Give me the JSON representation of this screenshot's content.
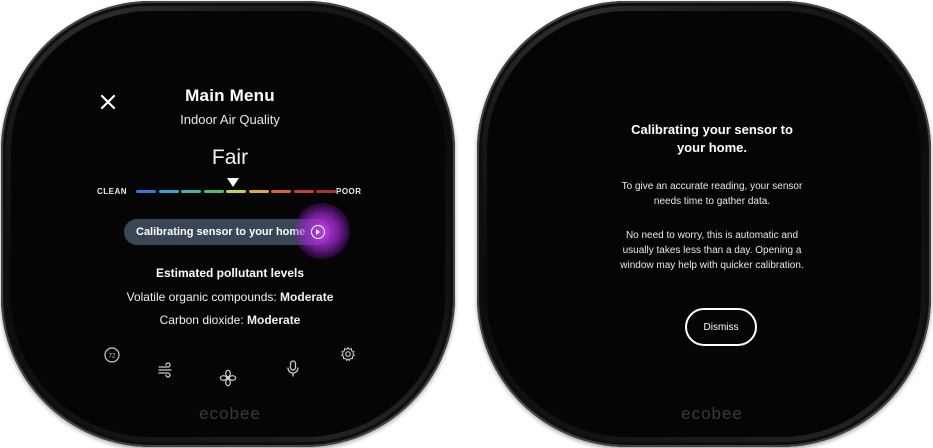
{
  "left_screen": {
    "title": "Main Menu",
    "subtitle": "Indoor Air Quality",
    "rating": "Fair",
    "scale_left": "CLEAN",
    "scale_right": "POOR",
    "scale_colors": [
      "#3a78d8",
      "#2fa6d9",
      "#3cb8a0",
      "#4cc06a",
      "#c9d341",
      "#e0a43a",
      "#d9603c",
      "#c93a3a",
      "#b32e2e"
    ],
    "calibration_pill": "Calibrating sensor to your home",
    "estimated_heading": "Estimated pollutant levels",
    "voc_label": "Volatile organic compounds: ",
    "voc_value": "Moderate",
    "co2_label": "Carbon dioxide: ",
    "co2_value": "Moderate",
    "temp_icon_text": "72",
    "brand": "ecobee"
  },
  "right_screen": {
    "title_line1": "Calibrating your sensor to",
    "title_line2": "your home.",
    "para1_line1": "To give an accurate reading, your sensor",
    "para1_line2": "needs time to gather data.",
    "para2_line1": "No need to worry, this is automatic and",
    "para2_line2": "usually takes less than a day. Opening a",
    "para2_line3": "window may help with quicker calibration.",
    "dismiss_label": "Dismiss",
    "brand": "ecobee"
  },
  "icons": {
    "close": "close-icon",
    "info_arrow": "chevron-right-icon",
    "temperature": "thermostat-icon",
    "air": "air-quality-icon",
    "fan": "fan-icon",
    "voice": "microphone-icon",
    "settings": "gear-icon"
  },
  "accent_color": "#b23ee0"
}
